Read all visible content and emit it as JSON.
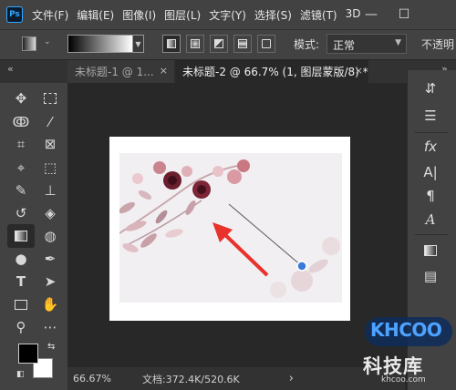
{
  "app": {
    "logo_text": "Ps"
  },
  "menu": [
    "文件(F)",
    "编辑(E)",
    "图像(I)",
    "图层(L)",
    "文字(Y)",
    "选择(S)",
    "滤镜(T)",
    "3D"
  ],
  "window_controls": {
    "minimize": "—",
    "maximize": "☐"
  },
  "options": {
    "mode_label": "模式:",
    "mode_value": "正常",
    "opacity_label": "不透明"
  },
  "tabs": [
    {
      "label": "未标题-1 @ 1...",
      "close": "×"
    },
    {
      "label": "未标题-2 @ 66.7% (1, 图层蒙版/8) *",
      "close": "×"
    }
  ],
  "panel_collapse": {
    "left": "«",
    "right": "»"
  },
  "status": {
    "zoom": "66.67%",
    "doc_info": "文档:372.4K/520.6K",
    "arrow": "›"
  },
  "colors": {
    "foreground": "#000000",
    "background": "#ffffff",
    "accent": "#31a8ff"
  },
  "watermark": {
    "brand": "KHCOO",
    "name_cn": "科技库",
    "url": "khcoo.com"
  },
  "tools": [
    "move-icon",
    "marquee-icon",
    "lasso-icon",
    "magic-wand-icon",
    "crop-icon",
    "frame-icon",
    "eyedropper-icon",
    "object-select-icon",
    "brush-icon",
    "stamp-icon",
    "history-brush-icon",
    "eraser-icon",
    "gradient-icon",
    "blur-icon",
    "dodge-icon",
    "pen-icon",
    "type-icon",
    "path-select-icon",
    "rectangle-icon",
    "hand-icon",
    "zoom-icon",
    "more-icon"
  ]
}
